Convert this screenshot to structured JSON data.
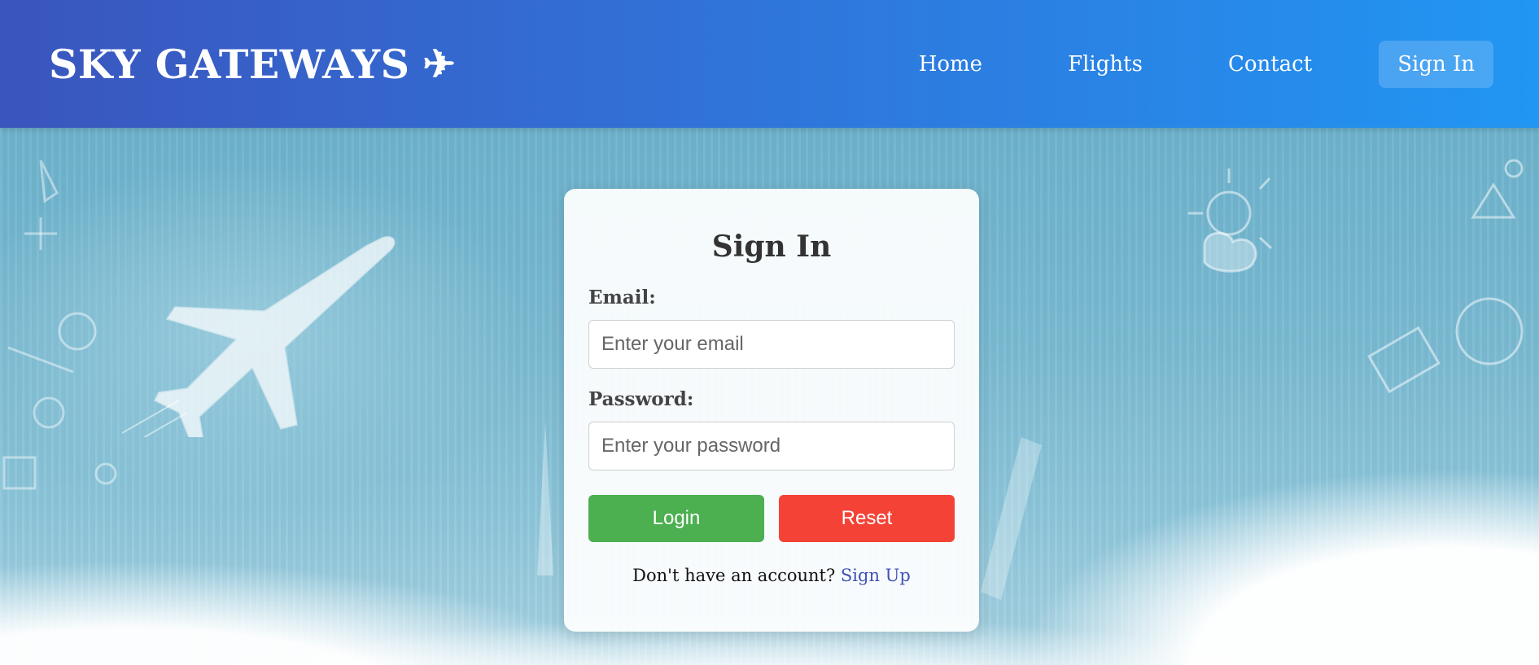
{
  "header": {
    "brand": "SKY GATEWAYS",
    "brand_icon": "✈",
    "nav": [
      {
        "label": "Home"
      },
      {
        "label": "Flights"
      },
      {
        "label": "Contact"
      },
      {
        "label": "Sign In"
      }
    ]
  },
  "form": {
    "title": "Sign In",
    "email_label": "Email:",
    "email_placeholder": "Enter your email",
    "password_label": "Password:",
    "password_placeholder": "Enter your password",
    "login_label": "Login",
    "reset_label": "Reset",
    "signup_prompt": "Don't have an account?",
    "signup_link": "Sign Up"
  },
  "colors": {
    "header_start": "#3a55bd",
    "header_end": "#2196f3",
    "login_button": "#4caf50",
    "reset_button": "#f44336",
    "link": "#3f51b5"
  }
}
